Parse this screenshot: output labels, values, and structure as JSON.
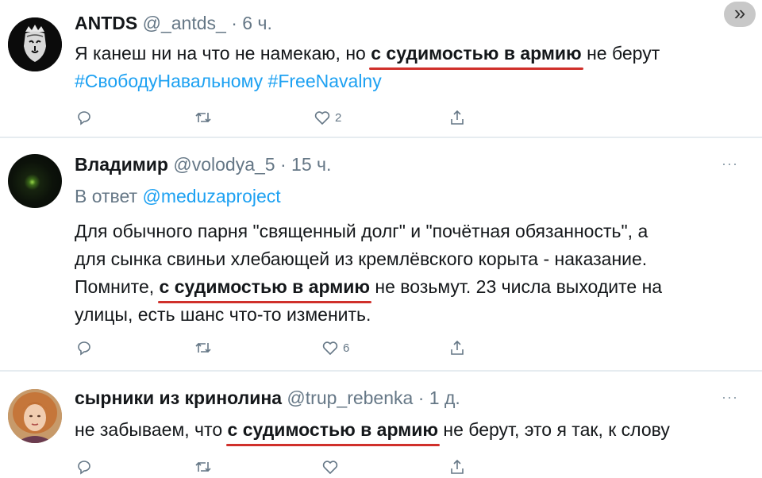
{
  "nav_button": {
    "label": "»"
  },
  "tweets": [
    {
      "name": "ANTDS",
      "handle": "@_antds_",
      "separator": "·",
      "time": "6 ч.",
      "text_before": "Я канеш ни на что не намекаю, но ",
      "highlight": "с судимостью в армию",
      "text_after": " не берут",
      "hashtags": [
        "#СвободуНавальному",
        "#FreeNavalny"
      ],
      "likes": "2"
    },
    {
      "name": "Владимир",
      "handle": "@volodya_5",
      "separator": "·",
      "time": "15 ч.",
      "reply_prefix": "В ответ ",
      "reply_mention": "@meduzaproject",
      "line1": "Для обычного парня \"священный долг\" и \"почётная обязанность\", а",
      "line2": "для сынка свиньи хлебающей из кремлёвского корыта - наказание.",
      "line3_before": "Помните, ",
      "highlight": "с судимостью в армию",
      "line3_after": " не возьмут. 23 числа выходите на",
      "line4": "улицы, есть шанс что-то изменить.",
      "likes": "6",
      "more": "···"
    },
    {
      "name": "сырники из кринолина",
      "handle": "@trup_rebenka",
      "separator": "·",
      "time": "1 д.",
      "text_before": "не забываем, что ",
      "highlight": "с судимостью в армию",
      "text_after": " не берут, это я так, к слову",
      "more": "···"
    }
  ],
  "icons": [
    "reply-icon",
    "retweet-icon",
    "like-icon",
    "share-icon"
  ],
  "colors": {
    "link": "#1da1f2",
    "muted": "#657786",
    "underline": "#d0302b",
    "divider": "#e6ecf0"
  }
}
